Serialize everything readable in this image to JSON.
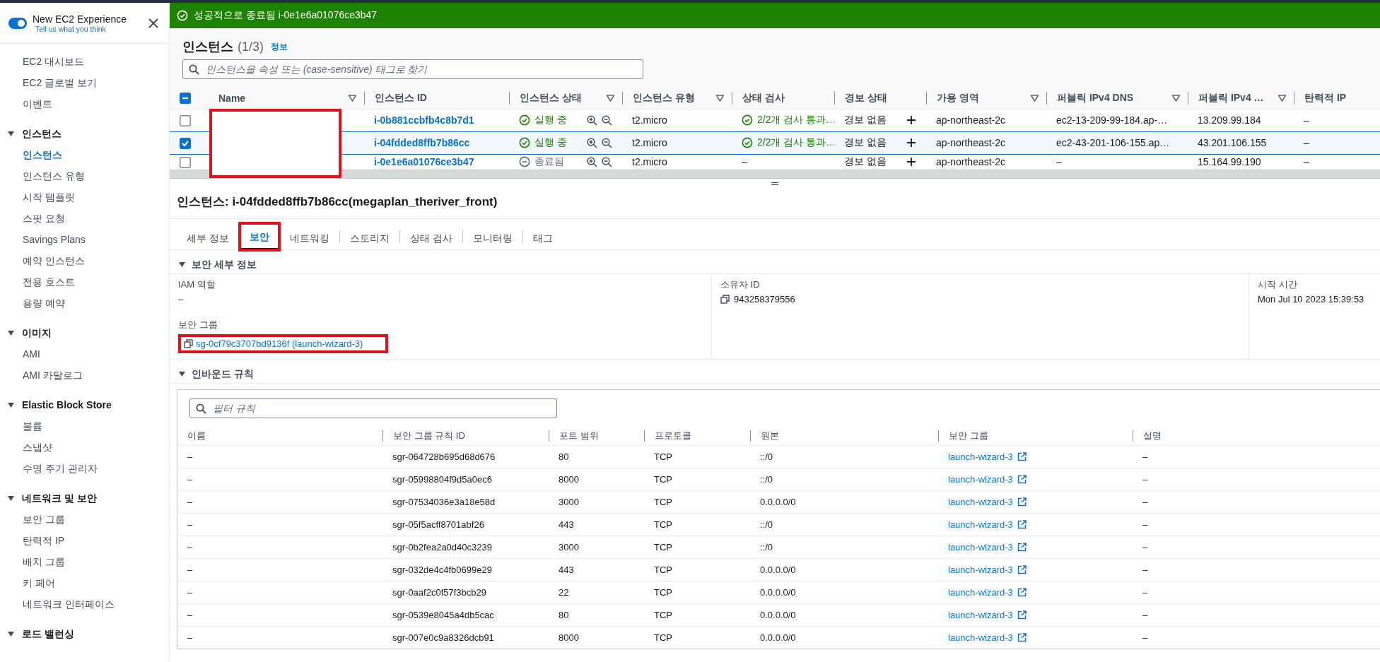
{
  "sidebar": {
    "toggle": {
      "label": "New EC2 Experience",
      "on": true
    },
    "feedback_link": "Tell us what you think",
    "items": [
      {
        "label": "EC2 대시보드",
        "selected": false
      },
      {
        "label": "EC2 글로벌 보기",
        "selected": false
      },
      {
        "label": "이벤트",
        "selected": false
      }
    ],
    "sections": [
      {
        "title": "인스턴스",
        "expanded": true,
        "items": [
          {
            "label": "인스턴스",
            "selected": true
          },
          {
            "label": "인스턴스 유형",
            "selected": false
          },
          {
            "label": "시작 템플릿",
            "selected": false
          },
          {
            "label": "스팟 요청",
            "selected": false
          },
          {
            "label": "Savings Plans",
            "selected": false
          },
          {
            "label": "예약 인스턴스",
            "selected": false
          },
          {
            "label": "전용 호스트",
            "selected": false
          },
          {
            "label": "용량 예약",
            "selected": false
          }
        ]
      },
      {
        "title": "이미지",
        "expanded": true,
        "items": [
          {
            "label": "AMI",
            "selected": false
          },
          {
            "label": "AMI 카탈로그",
            "selected": false
          }
        ]
      },
      {
        "title": "Elastic Block Store",
        "expanded": true,
        "items": [
          {
            "label": "볼륨",
            "selected": false
          },
          {
            "label": "스냅샷",
            "selected": false
          },
          {
            "label": "수명 주기 관리자",
            "selected": false
          }
        ]
      },
      {
        "title": "네트워크 및 보안",
        "expanded": true,
        "items": [
          {
            "label": "보안 그룹",
            "selected": false
          },
          {
            "label": "탄력적 IP",
            "selected": false
          },
          {
            "label": "배치 그룹",
            "selected": false
          },
          {
            "label": "키 페어",
            "selected": false
          },
          {
            "label": "네트워크 인터페이스",
            "selected": false
          }
        ]
      },
      {
        "title": "로드 밸런싱",
        "expanded": true
      }
    ]
  },
  "flash": {
    "kind": "success",
    "message": "성공적으로 종료됨 i-0e1e6a01076ce3b47"
  },
  "instances": {
    "title": "인스턴스",
    "count": "(1/3)",
    "info_link": "정보",
    "search_placeholder": "인스턴스을 속성 또는 (case-sensitive) 태그로 찾기",
    "select_all": {
      "checked": false,
      "indeterminate": true
    },
    "name_redacted": true,
    "columns": [
      {
        "label": "Name",
        "filter": true
      },
      {
        "label": "인스턴스 ID",
        "filter": false
      },
      {
        "label": "인스턴스 상태",
        "filter": true
      },
      {
        "label": "인스턴스 유형",
        "filter": true
      },
      {
        "label": "상태 검사",
        "filter": false
      },
      {
        "label": "경보 상태",
        "filter": false
      },
      {
        "label": "가용 영역",
        "filter": true
      },
      {
        "label": "퍼블릭 IPv4 DNS",
        "filter": true
      },
      {
        "label": "퍼블릭 IPv4 …",
        "filter": true
      },
      {
        "label": "탄력적 IP",
        "filter": false
      }
    ],
    "rows": [
      {
        "selected": false,
        "id": "i-0b881ccbfb4c8b7d1",
        "state": "실행 중",
        "terminated": false,
        "type": "t2.micro",
        "check": "2/2개 검사 통과…",
        "check_passed": true,
        "alarm": "경보 없음",
        "zone": "ap-northeast-2c",
        "dns": "ec2-13-209-99-184.ap-…",
        "ipv4": "13.209.99.184",
        "eip": "–"
      },
      {
        "selected": true,
        "id": "i-04fdded8ffb7b86cc",
        "state": "실행 중",
        "terminated": false,
        "type": "t2.micro",
        "check": "2/2개 검사 통과…",
        "check_passed": true,
        "alarm": "경보 없음",
        "zone": "ap-northeast-2c",
        "dns": "ec2-43-201-106-155.ap…",
        "ipv4": "43.201.106.155",
        "eip": "–"
      },
      {
        "selected": false,
        "id": "i-0e1e6a01076ce3b47",
        "state": "종료됨",
        "terminated": true,
        "type": "t2.micro",
        "check": "–",
        "check_passed": false,
        "alarm": "경보 없음",
        "zone": "ap-northeast-2c",
        "dns": "–",
        "ipv4": "15.164.99.190",
        "eip": "–"
      }
    ]
  },
  "detail": {
    "title": "인스턴스: i-04fdded8ffb7b86cc(megaplan_theriver_front)",
    "tabs": [
      {
        "label": "세부 정보",
        "selected": false,
        "highlighted": false
      },
      {
        "label": "보안",
        "selected": true,
        "highlighted": true
      },
      {
        "label": "네트워킹",
        "selected": false,
        "highlighted": false
      },
      {
        "label": "스토리지",
        "selected": false,
        "highlighted": false
      },
      {
        "label": "상태 검사",
        "selected": false,
        "highlighted": false
      },
      {
        "label": "모니터링",
        "selected": false,
        "highlighted": false
      },
      {
        "label": "태그",
        "selected": false,
        "highlighted": false
      }
    ],
    "security": {
      "title": "보안 세부 정보",
      "expanded": true,
      "iam_label": "IAM 역할",
      "iam_value": "–",
      "owner_label": "소유자 ID",
      "owner_value": "943258379556",
      "launch_label": "시작 시간",
      "launch_value": "Mon Jul 10 2023 15:39:53",
      "sg_label": "보안 그룹",
      "sg_link": "sg-0cf79c3707bd9136f (launch-wizard-3)",
      "sg_highlighted": true
    },
    "inbound": {
      "title": "인바운드 규칙",
      "expanded": true,
      "filter_placeholder": "필터 규칙",
      "columns": [
        "이름",
        "보안 그룹 규칙 ID",
        "포트 범위",
        "프로토콜",
        "원본",
        "보안 그룹",
        "설명"
      ],
      "rows": [
        [
          "–",
          "sgr-064728b695d68d676",
          "80",
          "TCP",
          "::/0",
          "launch-wizard-3",
          "–"
        ],
        [
          "–",
          "sgr-05998804f9d5a0ec6",
          "8000",
          "TCP",
          "::/0",
          "launch-wizard-3",
          "–"
        ],
        [
          "–",
          "sgr-07534036e3a18e58d",
          "3000",
          "TCP",
          "0.0.0.0/0",
          "launch-wizard-3",
          "–"
        ],
        [
          "–",
          "sgr-05f5acff8701abf26",
          "443",
          "TCP",
          "::/0",
          "launch-wizard-3",
          "–"
        ],
        [
          "–",
          "sgr-0b2fea2a0d40c3239",
          "3000",
          "TCP",
          "::/0",
          "launch-wizard-3",
          "–"
        ],
        [
          "–",
          "sgr-032de4c4fb0699e29",
          "443",
          "TCP",
          "0.0.0.0/0",
          "launch-wizard-3",
          "–"
        ],
        [
          "–",
          "sgr-0aaf2c0f57f3bcb29",
          "22",
          "TCP",
          "0.0.0.0/0",
          "launch-wizard-3",
          "–"
        ],
        [
          "–",
          "sgr-0539e8045a4db5cac",
          "80",
          "TCP",
          "0.0.0.0/0",
          "launch-wizard-3",
          "–"
        ],
        [
          "–",
          "sgr-007e0c9a8326dcb91",
          "8000",
          "TCP",
          "0.0.0.0/0",
          "launch-wizard-3",
          "–"
        ]
      ]
    }
  }
}
